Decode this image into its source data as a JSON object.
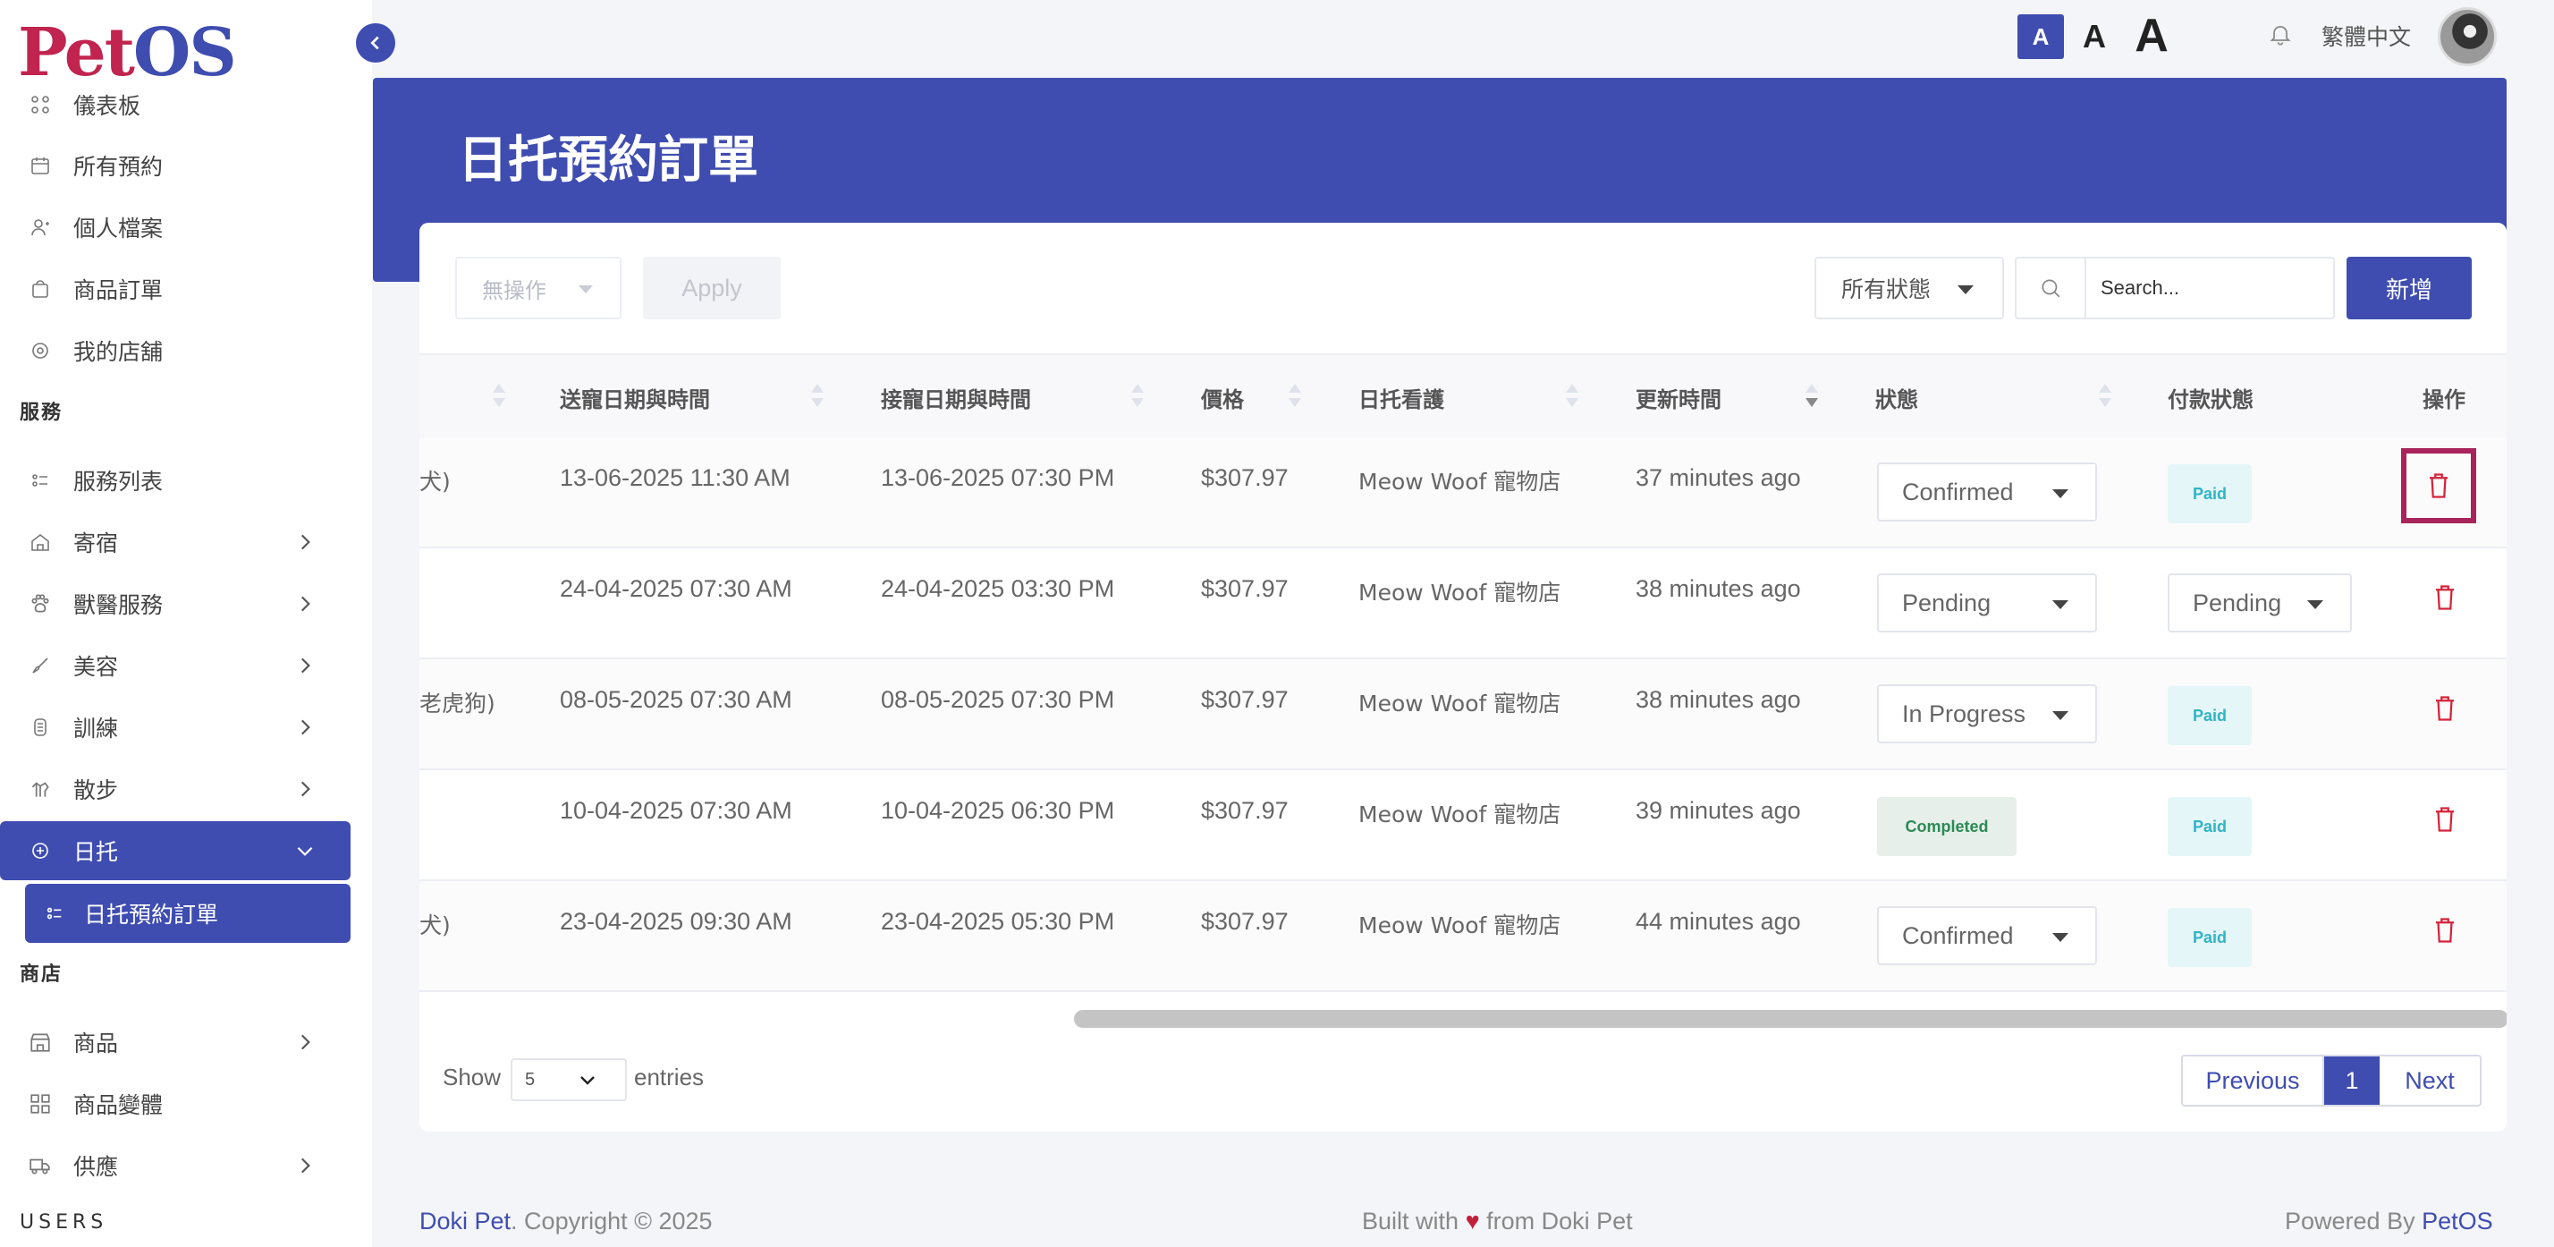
{
  "logo": {
    "pet": "Pet",
    "os": "OS"
  },
  "sidebar": {
    "items": [
      {
        "label": "儀表板",
        "icon": "dashboard-icon"
      },
      {
        "label": "所有預約",
        "icon": "calendar-icon"
      },
      {
        "label": "個人檔案",
        "icon": "user-icon"
      },
      {
        "label": "商品訂單",
        "icon": "bag-icon"
      },
      {
        "label": "我的店舖",
        "icon": "store-icon"
      }
    ],
    "section_services": "服務",
    "services": [
      {
        "label": "服務列表",
        "icon": "list-icon"
      },
      {
        "label": "寄宿",
        "icon": "home-icon"
      },
      {
        "label": "獸醫服務",
        "icon": "paw-icon"
      },
      {
        "label": "美容",
        "icon": "brush-icon"
      },
      {
        "label": "訓練",
        "icon": "training-icon"
      },
      {
        "label": "散步",
        "icon": "walk-icon"
      },
      {
        "label": "日托",
        "icon": "daycare-icon"
      },
      {
        "label": "日托預約訂單",
        "icon": "sub-list-icon"
      }
    ],
    "section_shop": "商店",
    "shop": [
      {
        "label": "商品",
        "icon": "shop-icon"
      },
      {
        "label": "商品變體",
        "icon": "variant-icon"
      },
      {
        "label": "供應",
        "icon": "truck-icon"
      }
    ],
    "section_users": "USERS"
  },
  "topbar": {
    "font_sizes": [
      "A",
      "A",
      "A"
    ],
    "language": "繁體中文"
  },
  "page": {
    "title": "日托預約訂單"
  },
  "toolbar": {
    "bulk_action": "無操作",
    "apply": "Apply",
    "status_filter": "所有狀態",
    "search_placeholder": "Search...",
    "add": "新增"
  },
  "table": {
    "headers": {
      "drop_off": "送寵日期與時間",
      "pick_up": "接寵日期與時間",
      "price": "價格",
      "caretaker": "日托看護",
      "updated": "更新時間",
      "status": "狀態",
      "payment": "付款狀態",
      "actions": "操作"
    },
    "rows": [
      {
        "pet_tail": "犬)",
        "drop_off": "13-06-2025 11:30 AM",
        "pick_up": "13-06-2025 07:30 PM",
        "price": "$307.97",
        "caretaker": "Meow Woof 寵物店",
        "updated": "37 minutes ago",
        "status": "Confirmed",
        "payment": "Paid"
      },
      {
        "pet_tail": "",
        "drop_off": "24-04-2025 07:30 AM",
        "pick_up": "24-04-2025 03:30 PM",
        "price": "$307.97",
        "caretaker": "Meow Woof 寵物店",
        "updated": "38 minutes ago",
        "status": "Pending",
        "payment": "Pending"
      },
      {
        "pet_tail": "老虎狗)",
        "drop_off": "08-05-2025 07:30 AM",
        "pick_up": "08-05-2025 07:30 PM",
        "price": "$307.97",
        "caretaker": "Meow Woof 寵物店",
        "updated": "38 minutes ago",
        "status": "In Progress",
        "payment": "Paid"
      },
      {
        "pet_tail": "",
        "drop_off": "10-04-2025 07:30 AM",
        "pick_up": "10-04-2025 06:30 PM",
        "price": "$307.97",
        "caretaker": "Meow Woof 寵物店",
        "updated": "39 minutes ago",
        "status": "Completed",
        "payment": "Paid"
      },
      {
        "pet_tail": "犬)",
        "drop_off": "23-04-2025 09:30 AM",
        "pick_up": "23-04-2025 05:30 PM",
        "price": "$307.97",
        "caretaker": "Meow Woof 寵物店",
        "updated": "44 minutes ago",
        "status": "Confirmed",
        "payment": "Paid"
      }
    ]
  },
  "pagination": {
    "show": "Show",
    "entries_value": "5",
    "entries": "entries",
    "previous": "Previous",
    "current": "1",
    "next": "Next"
  },
  "footer": {
    "brand": "Doki Pet",
    "copyright": ". Copyright © 2025",
    "built_prefix": "Built with",
    "built_suffix": "from Doki Pet",
    "powered_prefix": "Powered By ",
    "powered_brand": "PetOS"
  },
  "colors": {
    "primary": "#3f4db0",
    "brand_red": "#c0244f",
    "danger": "#d4243a"
  }
}
